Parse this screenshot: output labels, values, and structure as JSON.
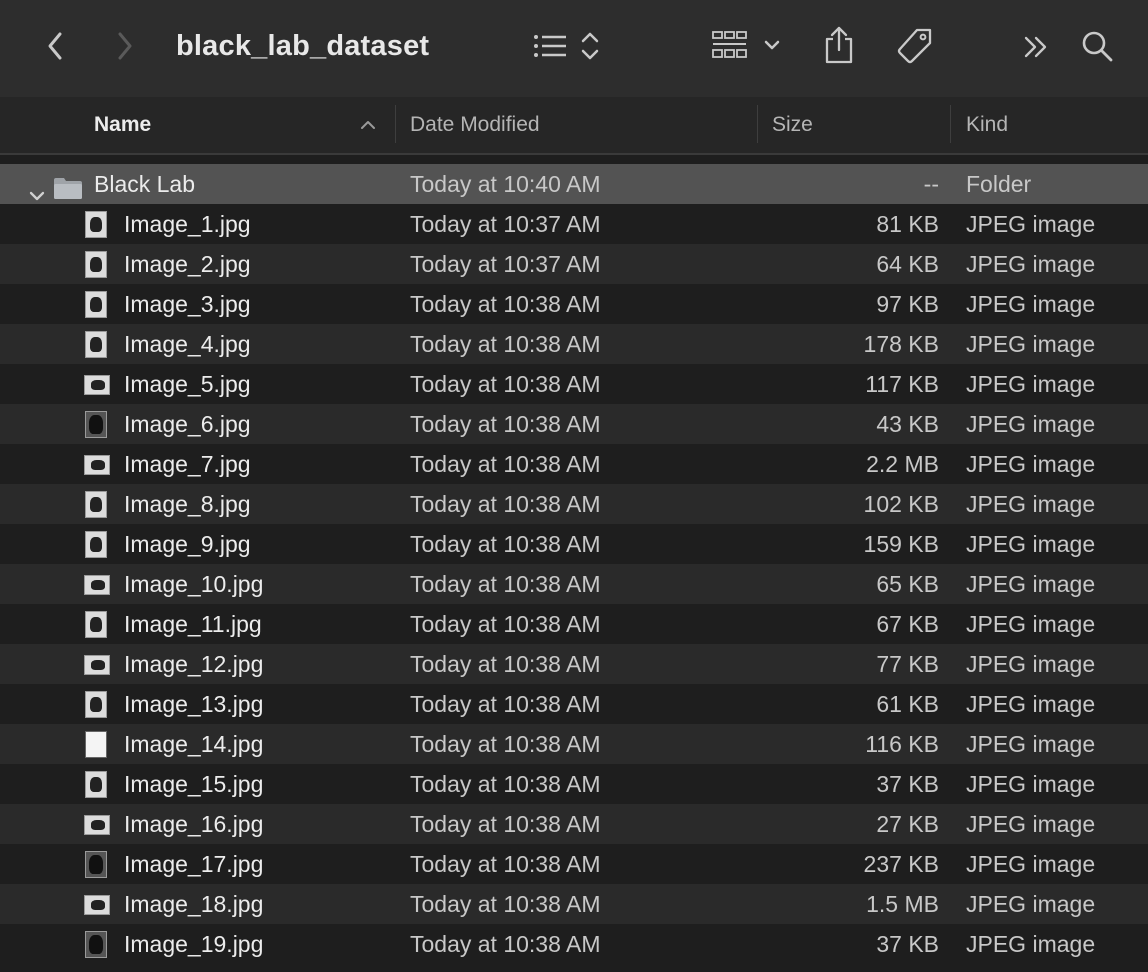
{
  "window": {
    "title": "black_lab_dataset",
    "toolbar_icons": [
      "back-chevron-icon",
      "forward-chevron-icon",
      "list-view-icon",
      "group-by-icon",
      "share-icon",
      "tag-icon",
      "more-overflow-icon",
      "search-icon"
    ]
  },
  "columns": {
    "name": "Name",
    "date": "Date Modified",
    "size": "Size",
    "kind": "Kind"
  },
  "folder": {
    "name": "Black Lab",
    "date": "Today at 10:40 AM",
    "size": "--",
    "kind": "Folder"
  },
  "files": [
    {
      "name": "Image_1.jpg",
      "date": "Today at 10:37 AM",
      "size": "81 KB",
      "kind": "JPEG image"
    },
    {
      "name": "Image_2.jpg",
      "date": "Today at 10:37 AM",
      "size": "64 KB",
      "kind": "JPEG image"
    },
    {
      "name": "Image_3.jpg",
      "date": "Today at 10:38 AM",
      "size": "97 KB",
      "kind": "JPEG image"
    },
    {
      "name": "Image_4.jpg",
      "date": "Today at 10:38 AM",
      "size": "178 KB",
      "kind": "JPEG image"
    },
    {
      "name": "Image_5.jpg",
      "date": "Today at 10:38 AM",
      "size": "117 KB",
      "kind": "JPEG image"
    },
    {
      "name": "Image_6.jpg",
      "date": "Today at 10:38 AM",
      "size": "43 KB",
      "kind": "JPEG image"
    },
    {
      "name": "Image_7.jpg",
      "date": "Today at 10:38 AM",
      "size": "2.2 MB",
      "kind": "JPEG image"
    },
    {
      "name": "Image_8.jpg",
      "date": "Today at 10:38 AM",
      "size": "102 KB",
      "kind": "JPEG image"
    },
    {
      "name": "Image_9.jpg",
      "date": "Today at 10:38 AM",
      "size": "159 KB",
      "kind": "JPEG image"
    },
    {
      "name": "Image_10.jpg",
      "date": "Today at 10:38 AM",
      "size": "65 KB",
      "kind": "JPEG image"
    },
    {
      "name": "Image_11.jpg",
      "date": "Today at 10:38 AM",
      "size": "67 KB",
      "kind": "JPEG image"
    },
    {
      "name": "Image_12.jpg",
      "date": "Today at 10:38 AM",
      "size": "77 KB",
      "kind": "JPEG image"
    },
    {
      "name": "Image_13.jpg",
      "date": "Today at 10:38 AM",
      "size": "61 KB",
      "kind": "JPEG image"
    },
    {
      "name": "Image_14.jpg",
      "date": "Today at 10:38 AM",
      "size": "116 KB",
      "kind": "JPEG image"
    },
    {
      "name": "Image_15.jpg",
      "date": "Today at 10:38 AM",
      "size": "37 KB",
      "kind": "JPEG image"
    },
    {
      "name": "Image_16.jpg",
      "date": "Today at 10:38 AM",
      "size": "27 KB",
      "kind": "JPEG image"
    },
    {
      "name": "Image_17.jpg",
      "date": "Today at 10:38 AM",
      "size": "237 KB",
      "kind": "JPEG image"
    },
    {
      "name": "Image_18.jpg",
      "date": "Today at 10:38 AM",
      "size": "1.5 MB",
      "kind": "JPEG image"
    },
    {
      "name": "Image_19.jpg",
      "date": "Today at 10:38 AM",
      "size": "37 KB",
      "kind": "JPEG image"
    }
  ],
  "colors": {
    "toolbar_bg": "#2d2d2d",
    "list_bg": "#1e1e1e",
    "alt_row_bg": "#2a2a2a",
    "folder_row_bg": "#535353"
  }
}
